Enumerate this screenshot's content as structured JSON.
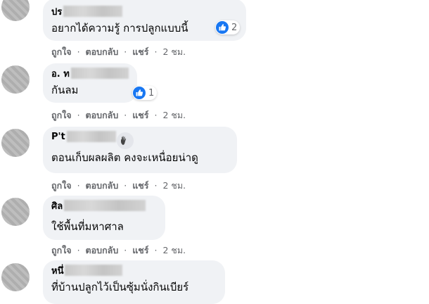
{
  "comments": [
    {
      "name": "ปร",
      "text": "อยากได้ความรู้ การปลูกแบบนี้",
      "like_count": "2",
      "actions": {
        "like": "ถูกใจ",
        "reply": "ตอบกลับ",
        "share": "แชร์",
        "time": "2 ชม."
      }
    },
    {
      "name": "อ. ท",
      "text": "กันลม",
      "like_count": "1",
      "actions": {
        "like": "ถูกใจ",
        "reply": "ตอบกลับ",
        "share": "แชร์",
        "time": "2 ชม."
      }
    },
    {
      "name": "P't",
      "text": "ตอนเก็บผลผลิต คงจะเหนื่อยน่าดู",
      "icon": "waving-hand-icon",
      "actions": {
        "like": "ถูกใจ",
        "reply": "ตอบกลับ",
        "share": "แชร์",
        "time": "2 ชม."
      }
    },
    {
      "name": "ศิล",
      "text": "ใช้พื้นที่มหาศาล",
      "actions": {
        "like": "ถูกใจ",
        "reply": "ตอบกลับ",
        "share": "แชร์",
        "time": "2 ชม."
      }
    },
    {
      "name": "หนึ่",
      "text": "ที่บ้านปลูกไว้เป็นซุ้มนั่งกินเบียร์"
    }
  ],
  "separator": "·",
  "colors": {
    "bubble": "#f0f2f5",
    "like_blue": "#1877f2",
    "meta_text": "#65676b"
  }
}
